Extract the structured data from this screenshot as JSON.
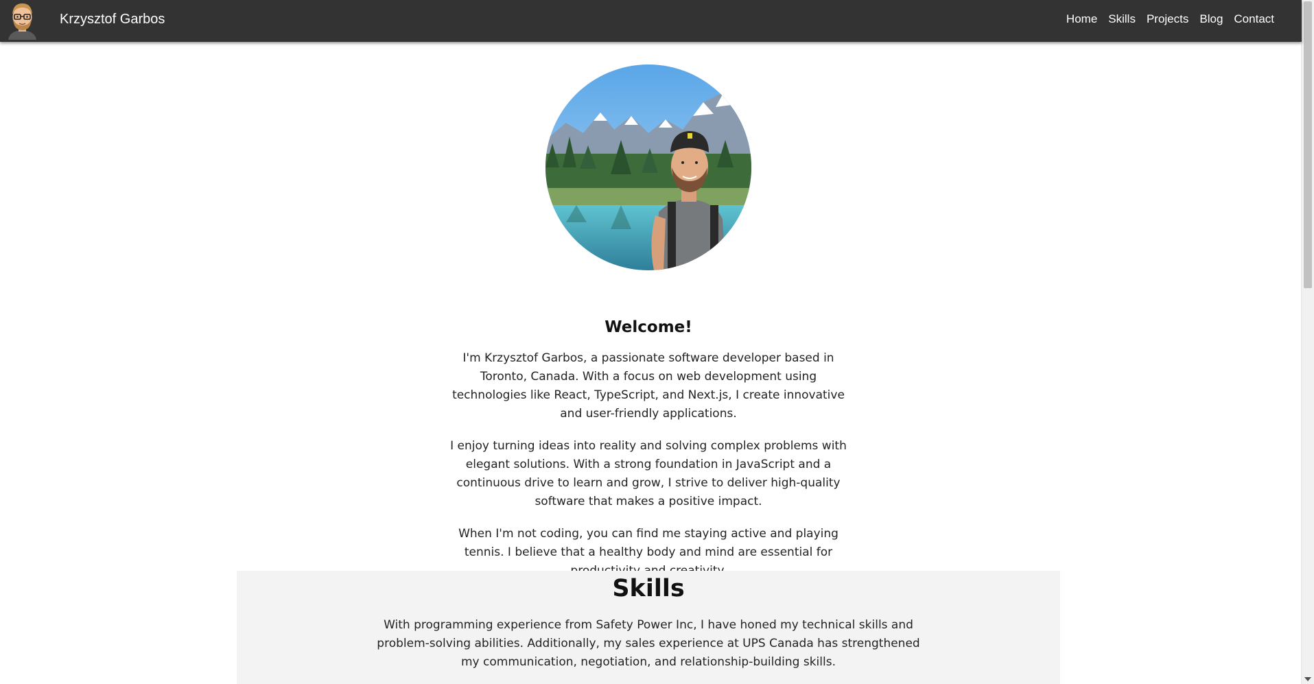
{
  "navbar": {
    "brand": "Krzysztof Garbos",
    "links": [
      "Home",
      "Skills",
      "Projects",
      "Blog",
      "Contact"
    ]
  },
  "about": {
    "heading": "Welcome!",
    "paragraphs": [
      "I'm Krzysztof Garbos, a passionate software developer based in Toronto, Canada. With a focus on web development using technologies like React, TypeScript, and Next.js, I create innovative and user-friendly applications.",
      "I enjoy turning ideas into reality and solving complex problems with elegant solutions. With a strong foundation in JavaScript and a continuous drive to learn and grow, I strive to deliver high-quality software that makes a positive impact.",
      "When I'm not coding, you can find me staying active and playing tennis. I believe that a healthy body and mind are essential for productivity and creativity."
    ]
  },
  "skills": {
    "heading": "Skills",
    "description": "With programming experience from Safety Power Inc, I have honed my technical skills and problem-solving abilities. Additionally, my sales experience at UPS Canada has strengthened my communication, negotiation, and relationship-building skills."
  },
  "colors": {
    "navbar_bg": "#333333",
    "nav_text": "#ffffff",
    "skills_bg": "#f3f3f3"
  }
}
